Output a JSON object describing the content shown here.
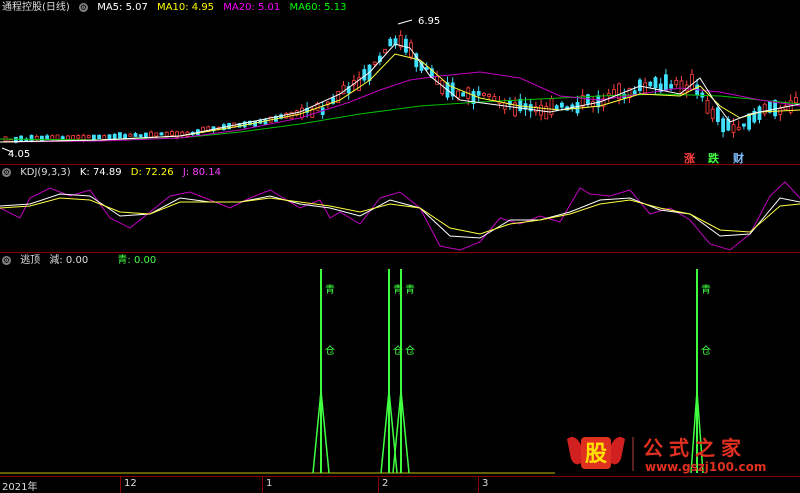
{
  "main": {
    "title": "通程控股(日线)",
    "ma": [
      {
        "label": "MA5: 5.07",
        "color": "#ffffff"
      },
      {
        "label": "MA10: 4.95",
        "color": "#ffff00"
      },
      {
        "label": "MA20: 5.01",
        "color": "#ff00ff"
      },
      {
        "label": "MA60: 5.13",
        "color": "#00ff00"
      }
    ],
    "high_label": "6.95",
    "low_label": "4.05",
    "buttons": [
      {
        "label": "涨",
        "color": "#ff4040"
      },
      {
        "label": "跌",
        "color": "#40ff40"
      },
      {
        "label": "财",
        "color": "#80c0ff"
      }
    ]
  },
  "kdj": {
    "title": "KDJ(9,3,3)",
    "k": "K: 74.89",
    "d": "D: 72.26",
    "j": "J: 80.14",
    "k_color": "#ffffff",
    "d_color": "#ffff00",
    "j_color": "#ff40ff"
  },
  "indicator": {
    "title": "逃顶",
    "v1": "減: 0.00",
    "v2": "青: 0.00",
    "signal_char1": "青",
    "signal_char2": "仓"
  },
  "axis": {
    "labels": [
      "2021年",
      "12",
      "1",
      "2",
      "3"
    ]
  },
  "logo": {
    "glyph": "股",
    "name": "公式之家",
    "url": "www.gszj100.com"
  }
}
